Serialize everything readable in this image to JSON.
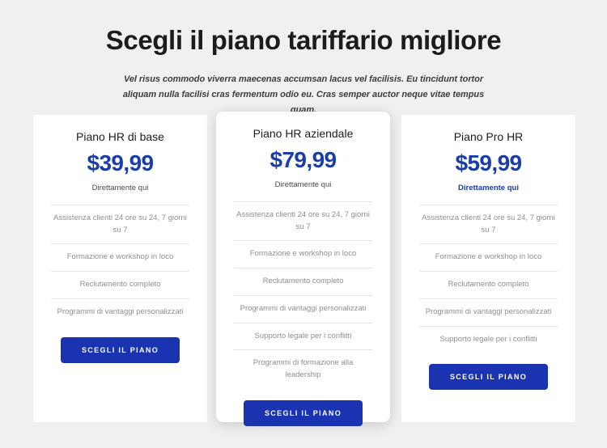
{
  "header": {
    "title": "Scegli il piano tariffario migliore",
    "subtitle": "Vel risus commodo viverra maecenas accumsan lacus vel facilisis. Eu tincidunt tortor aliquam nulla facilisi cras fermentum odio eu. Cras semper auctor neque vitae tempus quam."
  },
  "colors": {
    "page_background": "#f0f0f0",
    "card_background": "#ffffff",
    "accent_blue": "#1a3da8",
    "button_blue": "#1a33b0",
    "title_color": "#1c1c1c",
    "feature_text": "#8e8e8e",
    "divider": "#e4e4e4"
  },
  "plans": [
    {
      "name": "Piano HR di base",
      "price": "$39,99",
      "note": "Direttamente qui",
      "note_accent": false,
      "featured": false,
      "features": [
        "Assistenza clienti 24 ore su 24, 7 giorni su 7",
        "Formazione e workshop in loco",
        "Reclutamento completo",
        "Programmi di vantaggi personalizzati"
      ],
      "cta_label": "Scegli il piano"
    },
    {
      "name": "Piano HR aziendale",
      "price": "$79,99",
      "note": "Direttamente qui",
      "note_accent": false,
      "featured": true,
      "features": [
        "Assistenza clienti 24 ore su 24, 7 giorni su 7",
        "Formazione e workshop in loco",
        "Reclutamento completo",
        "Programmi di vantaggi personalizzati",
        "Supporto legale per i conflitti",
        "Programmi di formazione alla leadership"
      ],
      "cta_label": "Scegli il piano"
    },
    {
      "name": "Piano Pro HR",
      "price": "$59,99",
      "note": "Direttamente qui",
      "note_accent": true,
      "featured": false,
      "features": [
        "Assistenza clienti 24 ore su 24, 7 giorni su 7",
        "Formazione e workshop in loco",
        "Reclutamento completo",
        "Programmi di vantaggi personalizzati",
        "Supporto legale per i conflitti"
      ],
      "cta_label": "Scegli il piano"
    }
  ]
}
